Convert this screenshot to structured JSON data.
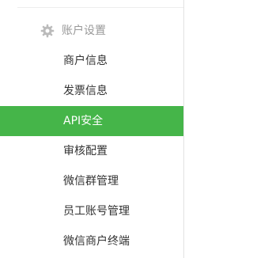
{
  "sidebar": {
    "section": {
      "title": "账户设置",
      "icon": "gear-icon"
    },
    "items": [
      {
        "label": "商户信息",
        "active": false
      },
      {
        "label": "发票信息",
        "active": false
      },
      {
        "label": "API安全",
        "active": true
      },
      {
        "label": "审核配置",
        "active": false
      },
      {
        "label": "微信群管理",
        "active": false
      },
      {
        "label": "员工账号管理",
        "active": false
      },
      {
        "label": "微信商户终端",
        "active": false
      }
    ]
  },
  "colors": {
    "active_background": "#45b549",
    "active_text": "#ffffff",
    "item_text": "#333333",
    "section_text": "#999999",
    "icon": "#bbbbbb"
  }
}
